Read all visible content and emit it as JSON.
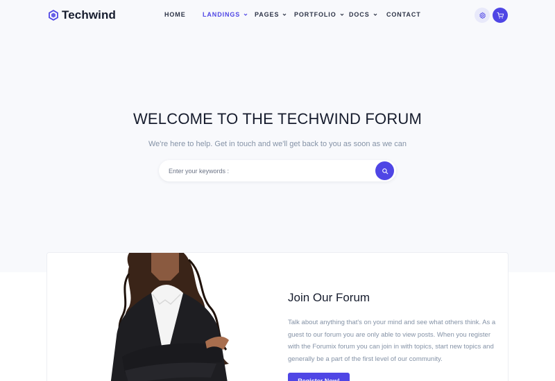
{
  "brand": {
    "name": "Techwind",
    "accent_color": "#4f46e5",
    "logo_icon": "hexagon-logo-icon"
  },
  "nav": {
    "items": [
      {
        "label": "HOME",
        "has_dropdown": false,
        "active": false
      },
      {
        "label": "LANDINGS",
        "has_dropdown": true,
        "active": true
      },
      {
        "label": "PAGES",
        "has_dropdown": true,
        "active": false
      },
      {
        "label": "PORTFOLIO",
        "has_dropdown": true,
        "active": false
      },
      {
        "label": "DOCS",
        "has_dropdown": true,
        "active": false
      },
      {
        "label": "CONTACT",
        "has_dropdown": false,
        "active": false
      }
    ],
    "settings_icon": "gear-icon",
    "cart_icon": "shopping-cart-icon"
  },
  "hero": {
    "title": "WELCOME TO THE TECHWIND FORUM",
    "subtitle": "We're here to help. Get in touch and we'll get back to you as soon as we can",
    "search_placeholder": "Enter your keywords :",
    "search_icon": "search-icon"
  },
  "card": {
    "title": "Join Our Forum",
    "text": "Talk about anything that's on your mind and see what others think. As a guest to our forum you are only able to view posts. When you register with the Forumix forum you can join in with topics, start new topics and generally be a part of the first level of our community.",
    "button_label": "Register Now!"
  }
}
